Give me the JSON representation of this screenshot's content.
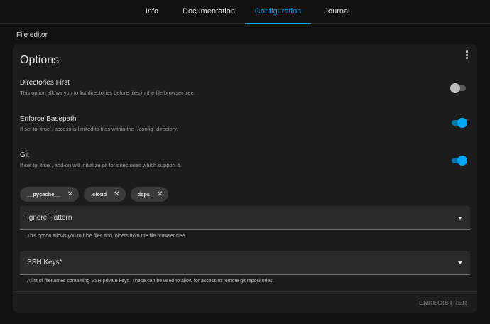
{
  "tabs": [
    {
      "label": "Info",
      "active": false
    },
    {
      "label": "Documentation",
      "active": false
    },
    {
      "label": "Configuration",
      "active": true
    },
    {
      "label": "Journal",
      "active": false
    }
  ],
  "section_title": "File editor",
  "card": {
    "title": "Options",
    "menu_icon": "more-vertical-icon",
    "options": [
      {
        "title": "Directories First",
        "description": "This option allows you to list directories before files in the file browser tree.",
        "enabled": false
      },
      {
        "title": "Enforce Basepath",
        "description": "If set to `true`, access is limited to files within the `/config` directory.",
        "enabled": true
      },
      {
        "title": "Git",
        "description": "If set to `true`, add-on will initialize git for directories which support it.",
        "enabled": true
      }
    ],
    "chips": [
      "__pycache__",
      ".cloud",
      "deps"
    ],
    "chip_remove_glyph": "✕",
    "ignore_pattern": {
      "label": "Ignore Pattern",
      "helper": "This option allows you to hide files and folders from the file browser tree."
    },
    "ssh_keys": {
      "label": "SSH Keys*",
      "helper": "A list of filenames containing SSH private keys. These can be used to allow for access to remote git repositories."
    },
    "save_label": "ENREGISTRER"
  },
  "colors": {
    "accent": "#03a9f4",
    "background": "#111111",
    "card": "#1c1c1c"
  }
}
